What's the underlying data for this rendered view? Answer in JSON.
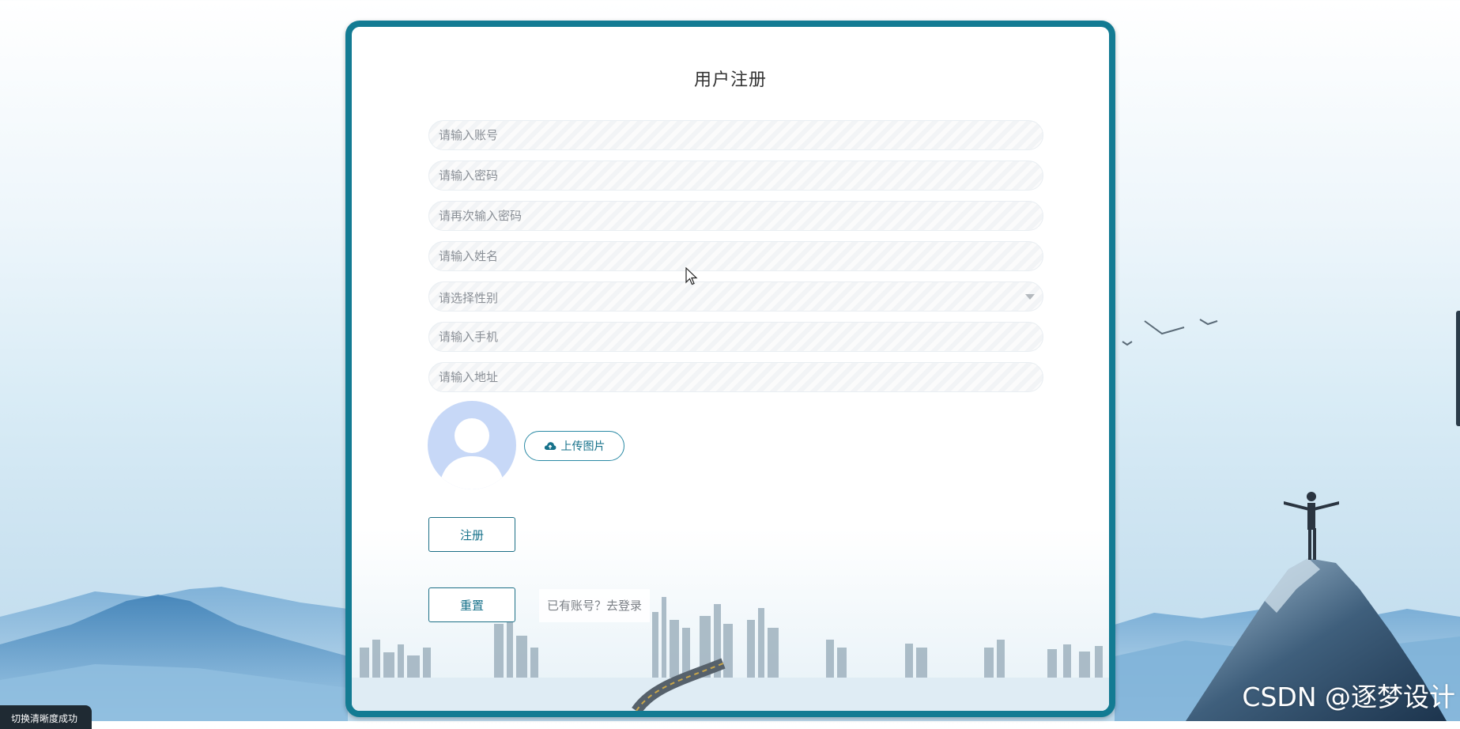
{
  "form": {
    "title": "用户注册",
    "account_placeholder": "请输入账号",
    "password_placeholder": "请输入密码",
    "confirm_password_placeholder": "请再次输入密码",
    "name_placeholder": "请输入姓名",
    "gender_placeholder": "请选择性别",
    "phone_placeholder": "请输入手机",
    "address_placeholder": "请输入地址",
    "upload_label": "上传图片",
    "register_label": "注册",
    "reset_label": "重置",
    "login_link": "已有账号？去登录"
  },
  "toast": {
    "text": "切换清晰度成功"
  },
  "watermark": {
    "text": "CSDN @逐梦设计"
  },
  "colors": {
    "primary": "#137b93",
    "avatar_bg": "#c7d8f7",
    "button_text": "#17728b"
  },
  "icons": {
    "upload": "cloud-upload-icon",
    "select": "chevron-down-icon",
    "avatar": "user-silhouette-icon"
  }
}
